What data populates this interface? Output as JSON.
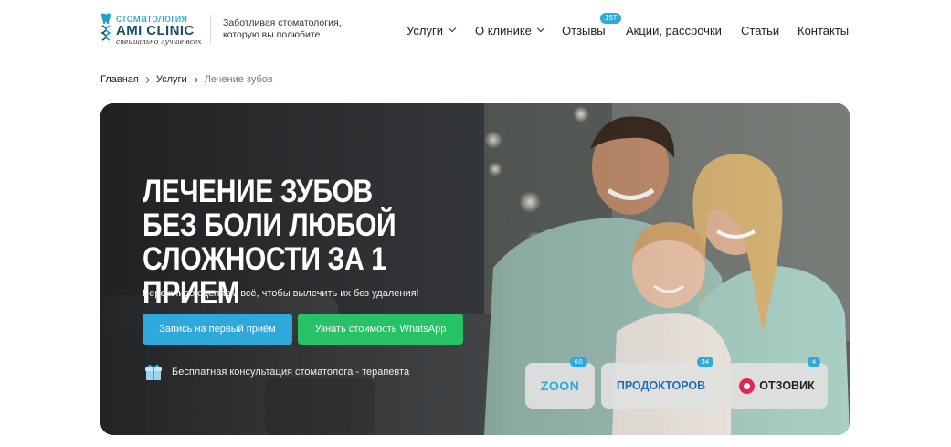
{
  "header": {
    "logo": {
      "top": "стоматология",
      "main": "AMI CLINIC",
      "sub": "специально лучше всех"
    },
    "tagline": "Заботливая стоматология, которую вы полюбите.",
    "nav": [
      {
        "label": "Услуги"
      },
      {
        "label": "О клинике"
      },
      {
        "label": "Отзывы",
        "badge": "157"
      },
      {
        "label": "Акции, рассрочки"
      },
      {
        "label": "Статьи"
      },
      {
        "label": "Контакты"
      }
    ]
  },
  "breadcrumb": [
    "Главная",
    "Услуги",
    "Лечение зубов"
  ],
  "hero": {
    "title_lines": [
      "Лечение зубов",
      "без боли любой",
      "сложности за 1 прием"
    ],
    "subtitle": "Бережливо сделаем всё, чтобы вылечить их без удаления!",
    "primary_button": "Запись на первый приём",
    "whatsapp_button": "Узнать стоимость WhatsApp",
    "consultation": "Бесплатная консультация стоматолога - терапевта",
    "reviews": [
      {
        "name": "ZOON",
        "count": "60"
      },
      {
        "name": "ПРОДОКТОРОВ",
        "count": "34"
      },
      {
        "name": "ОТЗОВИК",
        "count": "4"
      }
    ]
  },
  "colors": {
    "accent": "#2fa9dc",
    "whatsapp": "#27c266",
    "brand_dark": "#1f4d63"
  }
}
